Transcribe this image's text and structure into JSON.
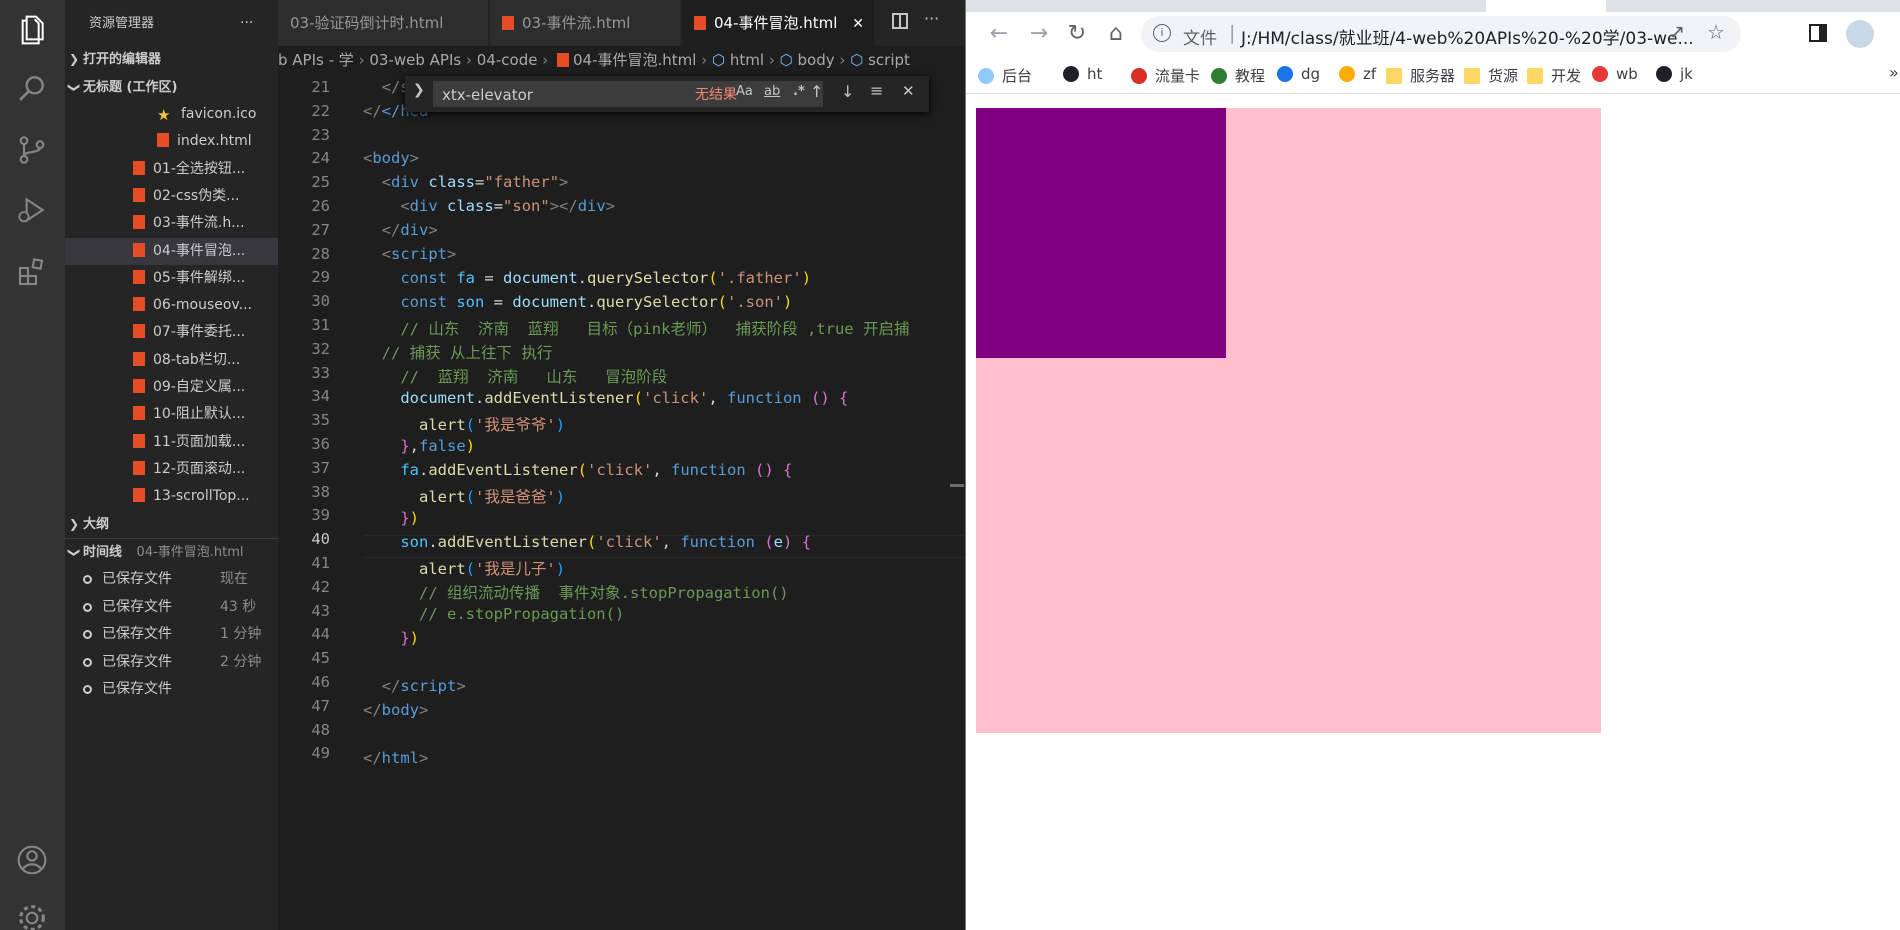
{
  "explorer": {
    "title": "资源管理器",
    "more": "···",
    "open_editors": "打开的编辑器",
    "workspace": "无标题 (工作区)",
    "files": [
      {
        "name": "favicon.ico",
        "type": "star"
      },
      {
        "name": "index.html",
        "type": "html"
      },
      {
        "name": "01-全选按钮...",
        "type": "html"
      },
      {
        "name": "02-css伪类...",
        "type": "html"
      },
      {
        "name": "03-事件流.h...",
        "type": "html"
      },
      {
        "name": "04-事件冒泡...",
        "type": "html"
      },
      {
        "name": "05-事件解绑...",
        "type": "html"
      },
      {
        "name": "06-mouseov...",
        "type": "html"
      },
      {
        "name": "07-事件委托...",
        "type": "html"
      },
      {
        "name": "08-tab栏切...",
        "type": "html"
      },
      {
        "name": "09-自定义属...",
        "type": "html"
      },
      {
        "name": "10-阻止默认...",
        "type": "html"
      },
      {
        "name": "11-页面加载...",
        "type": "html"
      },
      {
        "name": "12-页面滚动...",
        "type": "html"
      },
      {
        "name": "13-scrollTop...",
        "type": "html"
      }
    ],
    "outline": "大纲",
    "timeline": "时间线",
    "timeline_file": "04-事件冒泡.html",
    "timeline_items": [
      {
        "label": "已保存文件",
        "time": "现在"
      },
      {
        "label": "已保存文件",
        "time": "43 秒"
      },
      {
        "label": "已保存文件",
        "time": "1 分钟"
      },
      {
        "label": "已保存文件",
        "time": "2 分钟"
      },
      {
        "label": "已保存文件",
        "time": ""
      }
    ]
  },
  "tabs": [
    {
      "label": "03-验证码倒计时.html"
    },
    {
      "label": "03-事件流.html"
    },
    {
      "label": "04-事件冒泡.html",
      "close": "✕"
    }
  ],
  "breadcrumb": {
    "p1": "b APIs - 学",
    "p2": "03-web APIs",
    "p3": "04-code",
    "p4": "04-事件冒泡.html",
    "p5": "html",
    "p6": "body",
    "p7": "script"
  },
  "find": {
    "value": "xtx-elevator",
    "case": "Aa",
    "word": "ab",
    "regex": ".*",
    "result": "无结果"
  },
  "code": {
    "line_numbers": [
      "21",
      "22",
      "23",
      "24",
      "25",
      "26",
      "27",
      "28",
      "29",
      "30",
      "31",
      "32",
      "33",
      "34",
      "35",
      "36",
      "37",
      "38",
      "39",
      "40",
      "41",
      "42",
      "43",
      "44",
      "45",
      "46",
      "47",
      "48",
      "49"
    ],
    "current_line": "40",
    "l21a": "</s",
    "l22a": "</hea",
    "l22b": "d>",
    "l24": "body",
    "l25a": "div",
    "l25b": "class",
    "l25c": "\"father\"",
    "l26a": "div",
    "l26b": "class",
    "l26c": "\"son\"",
    "l26d": "div",
    "l27": "div",
    "l28": "script",
    "l29a": "const",
    "l29b": "fa",
    "l29c": "document",
    "l29d": "querySelector",
    "l29e": "'.father'",
    "l30a": "const",
    "l30b": "son",
    "l30c": "document",
    "l30d": "querySelector",
    "l30e": "'.son'",
    "l31": "// 山东  济南  蓝翔   目标（pink老师）  捕获阶段 ,true 开启捕",
    "l32": "// 捕获 从上往下 执行",
    "l33": "//  蓝翔  济南   山东   冒泡阶段",
    "l34a": "document",
    "l34b": "addEventListener",
    "l34c": "'click'",
    "l34d": "function",
    "l35a": "alert",
    "l35b": "'我是爷爷'",
    "l36a": "false",
    "l37a": "fa",
    "l37b": "addEventListener",
    "l37c": "'click'",
    "l37d": "function",
    "l38a": "alert",
    "l38b": "'我是爸爸'",
    "l40a": "son",
    "l40b": "addEventListener",
    "l40c": "'click'",
    "l40d": "function",
    "l40e": "e",
    "l41a": "alert",
    "l41b": "'我是儿子'",
    "l42": "// 组织流动传播  事件对象.stopPropagation()",
    "l43": "// e.stopPropagation()",
    "l46": "script",
    "l47": "body",
    "l49": "html"
  },
  "browser": {
    "url_label": "文件",
    "url": "J:/HM/class/就业班/4-web%20APIs%20-%20学/03-we...",
    "bookmarks": [
      {
        "label": "后台",
        "color": "#90caf9"
      },
      {
        "label": "ht",
        "color": "#202124"
      },
      {
        "label": "流量卡",
        "color": "#d93025"
      },
      {
        "label": "教程",
        "color": "#2e7d32"
      },
      {
        "label": "dg",
        "color": "#1a73e8"
      },
      {
        "label": "zf",
        "color": "#f9ab00"
      },
      {
        "label": "服务器",
        "color": "#fdd663"
      },
      {
        "label": "货源",
        "color": "#fdd663"
      },
      {
        "label": "开发",
        "color": "#fdd663"
      },
      {
        "label": "wb",
        "color": "#e53935"
      },
      {
        "label": "jk",
        "color": "#202124"
      }
    ],
    "more": "»",
    "father_color": "#ffc0cb",
    "son_color": "#800080"
  }
}
